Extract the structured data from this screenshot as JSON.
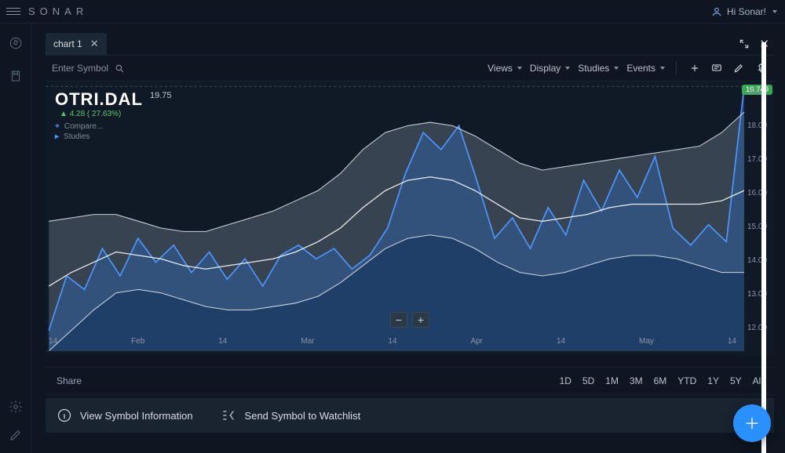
{
  "app": {
    "name": "SONAR"
  },
  "user": {
    "greeting": "Hi Sonar!"
  },
  "tab": {
    "label": "chart 1"
  },
  "toolbar": {
    "enter_symbol": "Enter Symbol",
    "views": "Views",
    "display": "Display",
    "studies": "Studies",
    "events": "Events"
  },
  "symbol": {
    "ticker": "OTRI.DAL",
    "last": "19.75",
    "delta": "4.28 ( 27.63%)",
    "badge": "19.749"
  },
  "legend": {
    "compare": "Compare...",
    "studies": "Studies"
  },
  "share": {
    "label": "Share"
  },
  "timeframes": [
    "1D",
    "5D",
    "1M",
    "3M",
    "6M",
    "YTD",
    "1Y",
    "5Y",
    "All"
  ],
  "actions": {
    "view_info": "View Symbol Information",
    "send_watchlist": "Send Symbol to Watchlist"
  },
  "chart_data": {
    "type": "area",
    "xlabel": "",
    "ylabel": "",
    "ylim": [
      12,
      19.75
    ],
    "x_ticks": [
      "14",
      "Feb",
      "14",
      "Mar",
      "14",
      "Apr",
      "14",
      "May",
      "14"
    ],
    "y_ticks": [
      19.0,
      18.0,
      17.0,
      16.0,
      15.0,
      14.0,
      13.0,
      12.0
    ],
    "series": [
      {
        "name": "Upper band",
        "role": "band-upper",
        "values": [
          15.8,
          15.9,
          16.0,
          16.0,
          15.8,
          15.6,
          15.5,
          15.5,
          15.7,
          15.9,
          16.1,
          16.4,
          16.7,
          17.2,
          17.9,
          18.4,
          18.6,
          18.7,
          18.6,
          18.3,
          17.9,
          17.5,
          17.3,
          17.4,
          17.5,
          17.6,
          17.7,
          17.8,
          17.9,
          18.0,
          18.4,
          19.0
        ]
      },
      {
        "name": "Lower band",
        "role": "band-lower",
        "values": [
          12.0,
          12.6,
          13.2,
          13.7,
          13.8,
          13.7,
          13.5,
          13.3,
          13.2,
          13.2,
          13.3,
          13.4,
          13.6,
          14.0,
          14.5,
          15.0,
          15.3,
          15.4,
          15.3,
          15.0,
          14.6,
          14.3,
          14.2,
          14.3,
          14.5,
          14.7,
          14.8,
          14.8,
          14.7,
          14.5,
          14.3,
          14.3
        ]
      },
      {
        "name": "Moving average",
        "role": "line-white",
        "values": [
          13.9,
          14.3,
          14.6,
          14.9,
          14.8,
          14.7,
          14.5,
          14.4,
          14.5,
          14.6,
          14.7,
          14.9,
          15.2,
          15.6,
          16.2,
          16.7,
          17.0,
          17.1,
          17.0,
          16.7,
          16.3,
          15.9,
          15.8,
          15.9,
          16.0,
          16.2,
          16.3,
          16.3,
          16.3,
          16.3,
          16.4,
          16.7
        ]
      },
      {
        "name": "OTRI.DAL",
        "role": "primary-area",
        "values": [
          12.6,
          14.2,
          13.8,
          15.0,
          14.2,
          15.3,
          14.6,
          15.1,
          14.3,
          14.9,
          14.1,
          14.7,
          13.9,
          14.8,
          15.1,
          14.7,
          15.0,
          14.4,
          14.8,
          15.6,
          17.2,
          18.4,
          17.9,
          18.6,
          17.0,
          15.3,
          15.9,
          15.0,
          16.2,
          15.4,
          17.0,
          16.1,
          17.3,
          16.5,
          17.7,
          15.6,
          15.1,
          15.7,
          15.2,
          19.75
        ]
      }
    ]
  }
}
